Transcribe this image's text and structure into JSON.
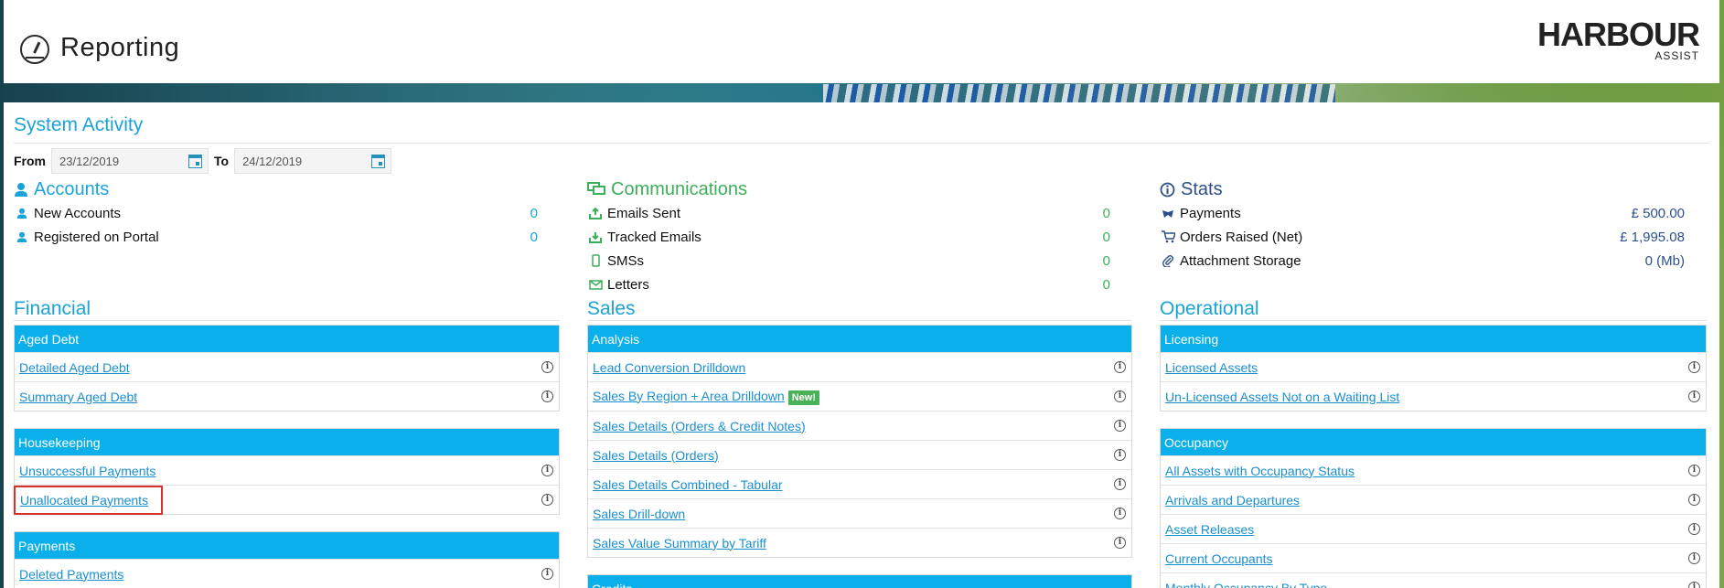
{
  "header": {
    "title": "Reporting",
    "logo_main": "HARBOUR",
    "logo_sub": "ASSIST"
  },
  "system_activity": {
    "title": "System Activity",
    "from_label": "From",
    "from_value": "23/12/2019",
    "to_label": "To",
    "to_value": "24/12/2019"
  },
  "accounts": {
    "title": "Accounts",
    "rows": [
      {
        "label": "New Accounts",
        "value": "0",
        "icon": "user-icon"
      },
      {
        "label": "Registered on Portal",
        "value": "0",
        "icon": "user-icon"
      }
    ]
  },
  "communications": {
    "title": "Communications",
    "rows": [
      {
        "label": "Emails Sent",
        "value": "0",
        "icon": "outbox-icon"
      },
      {
        "label": "Tracked Emails",
        "value": "0",
        "icon": "inbox-icon"
      },
      {
        "label": "SMSs",
        "value": "0",
        "icon": "mobile-icon"
      },
      {
        "label": "Letters",
        "value": "0",
        "icon": "envelope-icon"
      }
    ]
  },
  "stats": {
    "title": "Stats",
    "rows": [
      {
        "label": "Payments",
        "value": "£ 500.00",
        "icon": "payments-icon"
      },
      {
        "label": "Orders Raised (Net)",
        "value": "£ 1,995.08",
        "icon": "cart-icon"
      },
      {
        "label": "Attachment Storage",
        "value": "0 (Mb)",
        "icon": "paperclip-icon"
      }
    ]
  },
  "financial": {
    "title": "Financial",
    "aged_debt": {
      "header": "Aged Debt",
      "items": [
        "Detailed Aged Debt",
        "Summary Aged Debt"
      ]
    },
    "housekeeping": {
      "header": "Housekeeping",
      "items": [
        "Unsuccessful Payments",
        "Unallocated Payments"
      ]
    },
    "payments": {
      "header": "Payments",
      "items": [
        "Deleted Payments"
      ]
    }
  },
  "sales": {
    "title": "Sales",
    "analysis": {
      "header": "Analysis",
      "items": [
        "Lead Conversion Drilldown",
        "Sales By Region + Area Drilldown",
        "Sales Details (Orders & Credit Notes)",
        "Sales Details (Orders)",
        "Sales Details Combined - Tabular",
        "Sales Drill-down",
        "Sales Value Summary by Tariff"
      ],
      "new_badge": "New!"
    },
    "credits": {
      "header": "Credits"
    }
  },
  "operational": {
    "title": "Operational",
    "licensing": {
      "header": "Licensing",
      "items": [
        "Licensed Assets",
        "Un-Licensed Assets Not on a Waiting List"
      ]
    },
    "occupancy": {
      "header": "Occupancy",
      "items": [
        "All Assets with Occupancy Status",
        "Arrivals and Departures",
        "Asset Releases",
        "Current Occupants",
        "Monthly Occupancy By Type"
      ]
    }
  },
  "colors": {
    "accent": "#1aa3d9",
    "table_header": "#0bb0ea",
    "green": "#3daf5a",
    "navy": "#2c4f8a",
    "highlight": "#d6332f"
  }
}
